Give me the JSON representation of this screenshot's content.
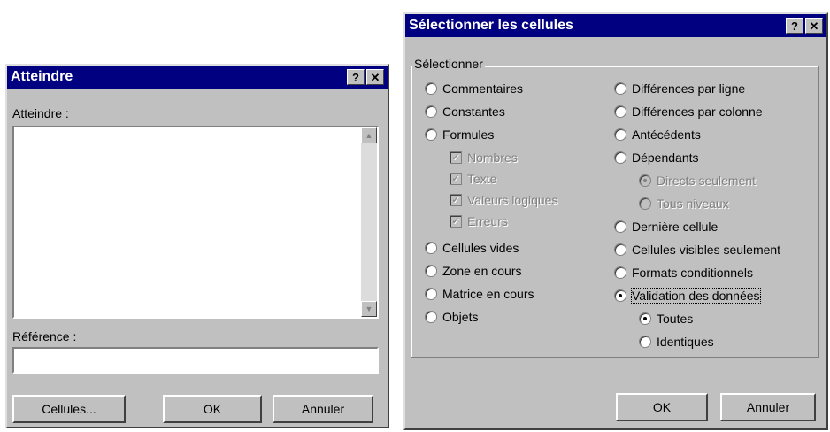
{
  "atteindre": {
    "title": "Atteindre",
    "help_btn": "?",
    "close_btn": "✕",
    "list_label": "Atteindre :",
    "reference_label": "Référence :",
    "reference_value": "",
    "buttons": {
      "cellules": "Cellules...",
      "ok": "OK",
      "annuler": "Annuler"
    }
  },
  "selection": {
    "title": "Sélectionner les cellules",
    "help_btn": "?",
    "close_btn": "✕",
    "group_label": "Sélectionner",
    "left_options": [
      "Commentaires",
      "Constantes",
      "Formules"
    ],
    "formules_sub": [
      "Nombres",
      "Texte",
      "Valeurs logiques",
      "Erreurs"
    ],
    "left_options2": [
      "Cellules vides",
      "Zone en cours",
      "Matrice en cours",
      "Objets"
    ],
    "right_options": [
      "Différences par ligne",
      "Différences par colonne",
      "Antécédents",
      "Dépendants"
    ],
    "dependants_sub": [
      "Directs seulement",
      "Tous niveaux"
    ],
    "right_options2": [
      "Dernière cellule",
      "Cellules visibles seulement",
      "Formats conditionnels",
      "Validation des données"
    ],
    "validation_sub": [
      "Toutes",
      "Identiques"
    ],
    "selected": "Validation des données",
    "validation_selected": "Toutes",
    "buttons": {
      "ok": "OK",
      "annuler": "Annuler"
    }
  }
}
